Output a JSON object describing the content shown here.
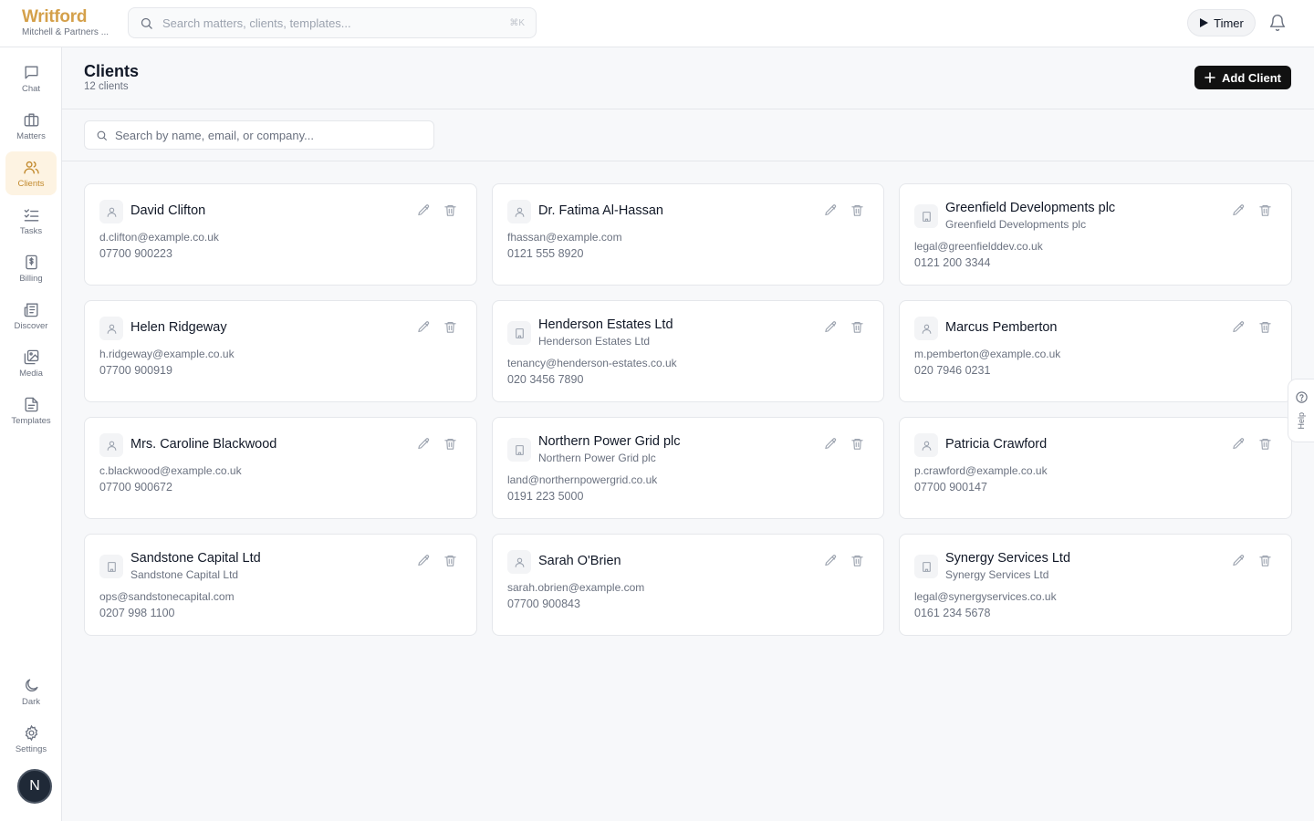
{
  "brand": {
    "name": "Writford",
    "org": "Mitchell & Partners ..."
  },
  "search": {
    "placeholder": "Search matters, clients, templates...",
    "shortcut": "⌘K"
  },
  "timer": {
    "label": "Timer"
  },
  "nav": {
    "chat": "Chat",
    "matters": "Matters",
    "clients": "Clients",
    "tasks": "Tasks",
    "billing": "Billing",
    "discover": "Discover",
    "media": "Media",
    "templates": "Templates",
    "dark": "Dark",
    "settings": "Settings"
  },
  "user": {
    "initial": "N"
  },
  "page": {
    "title": "Clients",
    "count": "12 clients",
    "add_label": "Add Client"
  },
  "filter": {
    "placeholder": "Search by name, email, or company..."
  },
  "clients": [
    {
      "name": "David Clifton",
      "company": "",
      "email": "d.clifton@example.co.uk",
      "phone": "07700 900223"
    },
    {
      "name": "Dr. Fatima Al-Hassan",
      "company": "",
      "email": "fhassan@example.com",
      "phone": "0121 555 8920"
    },
    {
      "name": "Greenfield Developments plc",
      "company": "Greenfield Developments plc",
      "email": "legal@greenfielddev.co.uk",
      "phone": "0121 200 3344"
    },
    {
      "name": "Helen Ridgeway",
      "company": "",
      "email": "h.ridgeway@example.co.uk",
      "phone": "07700 900919"
    },
    {
      "name": "Henderson Estates Ltd",
      "company": "Henderson Estates Ltd",
      "email": "tenancy@henderson-estates.co.uk",
      "phone": "020 3456 7890"
    },
    {
      "name": "Marcus Pemberton",
      "company": "",
      "email": "m.pemberton@example.co.uk",
      "phone": "020 7946 0231"
    },
    {
      "name": "Mrs. Caroline Blackwood",
      "company": "",
      "email": "c.blackwood@example.co.uk",
      "phone": "07700 900672"
    },
    {
      "name": "Northern Power Grid plc",
      "company": "Northern Power Grid plc",
      "email": "land@northernpowergrid.co.uk",
      "phone": "0191 223 5000"
    },
    {
      "name": "Patricia Crawford",
      "company": "",
      "email": "p.crawford@example.co.uk",
      "phone": "07700 900147"
    },
    {
      "name": "Sandstone Capital Ltd",
      "company": "Sandstone Capital Ltd",
      "email": "ops@sandstonecapital.com",
      "phone": "0207 998 1100"
    },
    {
      "name": "Sarah O'Brien",
      "company": "",
      "email": "sarah.obrien@example.com",
      "phone": "07700 900843"
    },
    {
      "name": "Synergy Services Ltd",
      "company": "Synergy Services Ltd",
      "email": "legal@synergyservices.co.uk",
      "phone": "0161 234 5678"
    }
  ],
  "help": {
    "label": "Help"
  },
  "colors": {
    "brand": "#d4a04a",
    "active_nav_bg": "#fdf3e2",
    "primary_button": "#111111"
  }
}
